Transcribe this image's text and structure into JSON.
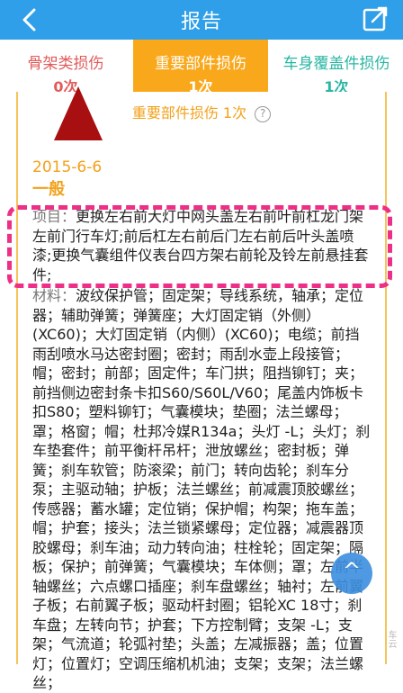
{
  "header": {
    "title": "报告",
    "back_icon": "back-arrow-icon",
    "share_icon": "share-icon",
    "bg_color": "#2e9fe8"
  },
  "tabs": [
    {
      "label": "骨架类损伤",
      "count": "0次",
      "color": "#e25a5a",
      "active": false
    },
    {
      "label": "重要部件损伤",
      "count": "1次",
      "color": "#f9a81b",
      "active": true
    },
    {
      "label": "车身覆盖件损伤",
      "count": "1次",
      "color": "#29b6a4",
      "active": false
    }
  ],
  "section": {
    "title": "重要部件损伤 1次",
    "help_icon": "help-circle-icon",
    "accent_color": "#f2a11a"
  },
  "record": {
    "date": "2015-6-6",
    "severity": "一般",
    "items_label": "项目：",
    "items_value": "更换左右前大灯中网头盖左右前叶前杠龙门架左前门行车灯;前后杠左右前后门左右前后叶头盖喷漆;更换气囊组件仪表台四方架右前轮及铃左前悬挂套件;",
    "materials_label": "材料：",
    "materials_value": "波纹保护管；固定架；导线系统，轴承；定位器；辅助弹簧；弹簧座；大灯固定销（外侧）(XC60)；大灯固定销（内侧）(XC60)；电缆；前挡雨刮喷水马达密封圈；密封；雨刮水壶上段接管；帽；密封；前部；固定件；车门拱；阻挡铆钉；夹；前挡侧边密封条卡扣S60/S60L/V60；尾盖内饰板卡扣S80；塑料铆钉；气囊模块；垫圈；法兰螺母；罩；格窗；帽；杜邦冷媒R134a；头灯 -L；头灯；刹车垫套件；前平衡杆吊杆；泄放螺丝；密封板；弹簧；刹车软管；防滚梁；前门；转向齿轮；刹车分泵；主驱动轴；护板；法兰螺丝；前减震顶胶螺丝；传感器；蓄水罐；定位销；保护帽；构架；拖车盖；帽；护套；接头；法兰锁紧螺母；定位器；减震器顶胶螺母；刹车油；动力转向油；柱栓轮；固定架；隔板；保护；前弹簧；气囊模块；车体侧；罩；左前半轴螺丝；六点螺口插座；刹车盘螺丝；轴衬；左前翼子板；右前翼子板；驱动杆封圈；铝轮XC 18寸；刹车盘；左转向节；护套；下方控制臂；支架 -L；支架；气流道；轮弧衬垫；头盖；左减振器；盖；位置灯；位置灯；空调压缩机机油；支架；支架；法兰螺丝；"
  },
  "annotations": {
    "arrow_color": "#a80f10",
    "highlight_color": "#ee2f87"
  },
  "float_button": {
    "icon": "chevron-up-icon",
    "glyph": "^"
  },
  "watermark": "车云"
}
